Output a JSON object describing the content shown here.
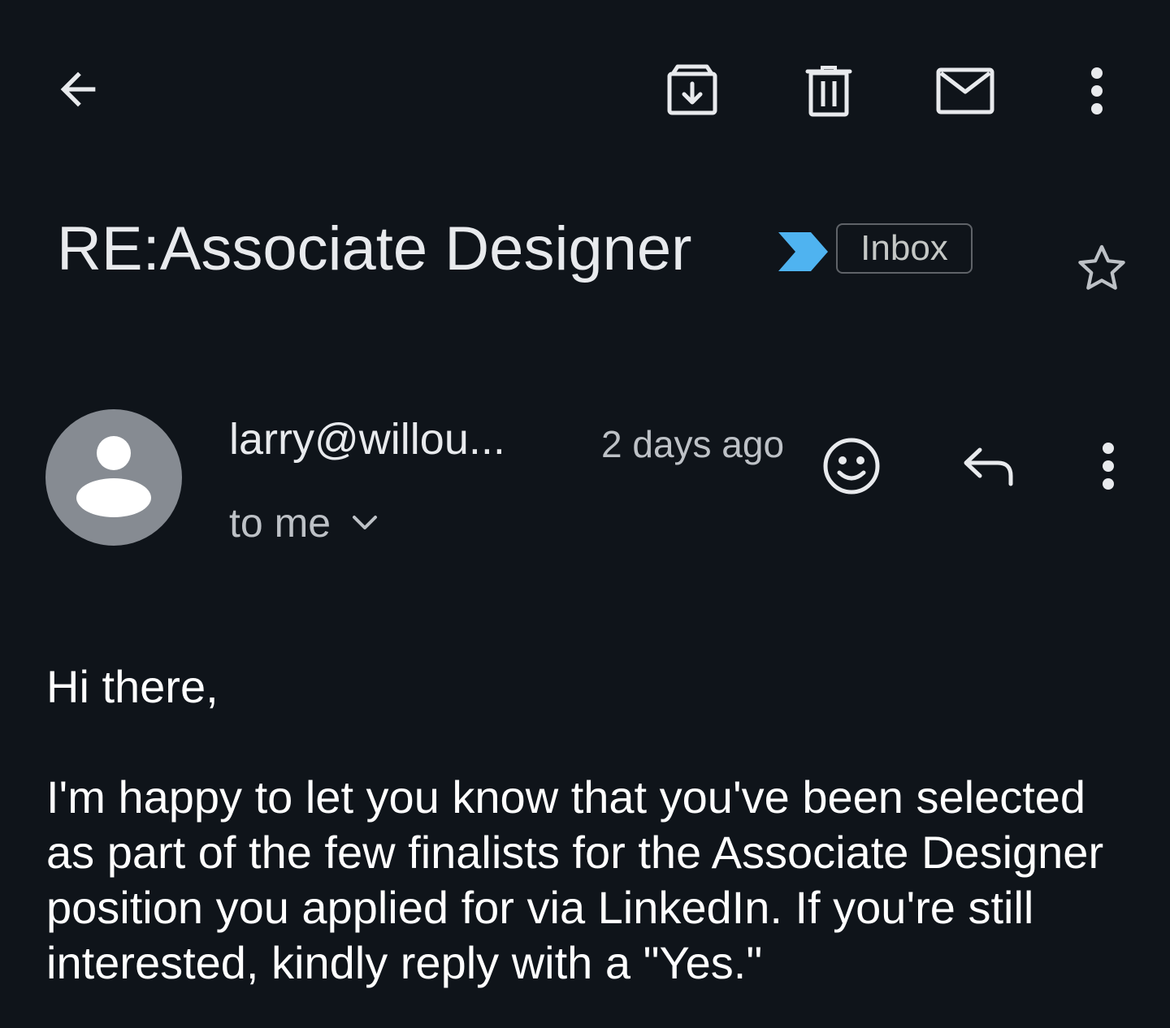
{
  "toolbar": {
    "back_icon": "arrow-back-icon",
    "archive_icon": "archive-icon",
    "delete_icon": "trash-icon",
    "mark_unread_icon": "mail-icon",
    "more_icon": "more-vert-icon"
  },
  "email": {
    "subject": "RE:Associate Designer",
    "importance_icon": "importance-marker-icon",
    "importance_color": "#4fb3f0",
    "label": "Inbox",
    "starred": false,
    "sender": "larry@willou...",
    "time": "2 days ago",
    "recipients": "to me",
    "body": {
      "greeting": "Hi there,",
      "paragraph": "I'm happy to let you know that you've been selected as part of the few finalists for the Associate Designer position you applied for via LinkedIn. If you're still interested, kindly reply with a \"Yes.\""
    }
  },
  "message_actions": {
    "react_icon": "smiley-icon",
    "reply_icon": "reply-icon",
    "more_icon": "more-vert-icon"
  },
  "colors": {
    "background": "#0f141a",
    "text_primary": "#e8eaed",
    "text_secondary": "#bdc1c6",
    "avatar_bg": "#868b92"
  }
}
